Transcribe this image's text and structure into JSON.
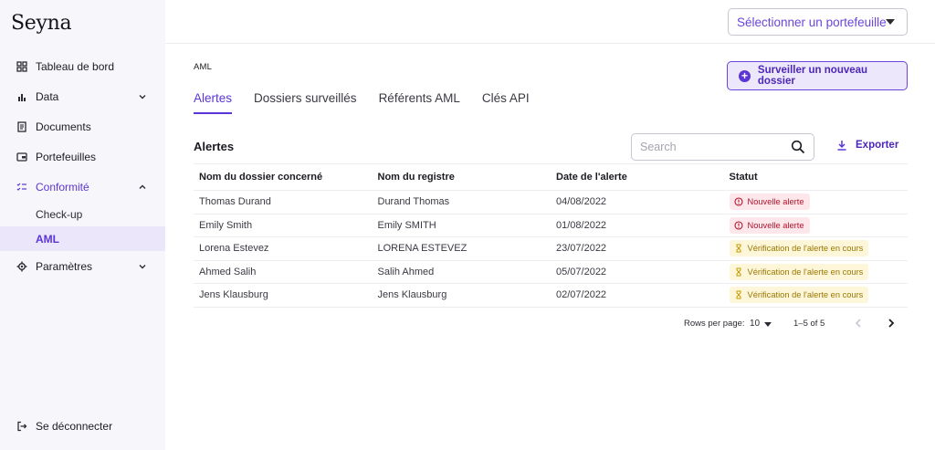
{
  "app": {
    "logo": "Seyna"
  },
  "sidebar": {
    "items": [
      {
        "label": "Tableau de bord",
        "icon": "dashboard-icon"
      },
      {
        "label": "Data",
        "icon": "bar-chart-icon"
      },
      {
        "label": "Documents",
        "icon": "document-icon"
      },
      {
        "label": "Portefeuilles",
        "icon": "wallet-icon"
      },
      {
        "label": "Conformité",
        "icon": "checklist-icon"
      },
      {
        "label": "Paramètres",
        "icon": "gear-icon"
      }
    ],
    "subitems": [
      {
        "label": "Check-up"
      },
      {
        "label": "AML"
      }
    ],
    "logout": "Se déconnecter"
  },
  "topbar": {
    "portfolio_select": "Sélectionner un portefeuille"
  },
  "main": {
    "breadcrumb": "AML",
    "primary_button": "Surveiller un nouveau dossier",
    "tabs": [
      "Alertes",
      "Dossiers surveillés",
      "Référents AML",
      "Clés API"
    ],
    "section_title": "Alertes",
    "search_placeholder": "Search",
    "export_label": "Exporter"
  },
  "table": {
    "headers": [
      "Nom du dossier concerné",
      "Nom du registre",
      "Date de l'alerte",
      "Statut"
    ],
    "rows": [
      {
        "dossier": "Thomas Durand",
        "registre": "Durand Thomas",
        "date": "04/08/2022",
        "status": "Nouvelle alerte",
        "status_type": "alert"
      },
      {
        "dossier": "Emily Smith",
        "registre": "Emily SMITH",
        "date": "01/08/2022",
        "status": "Nouvelle alerte",
        "status_type": "alert"
      },
      {
        "dossier": "Lorena Estevez",
        "registre": "LORENA ESTEVEZ",
        "date": "23/07/2022",
        "status": "Vérification de l'alerte en cours",
        "status_type": "pending"
      },
      {
        "dossier": "Ahmed Salih",
        "registre": "Salih Ahmed",
        "date": "05/07/2022",
        "status": "Vérification de l'alerte en cours",
        "status_type": "pending"
      },
      {
        "dossier": "Jens Klausburg",
        "registre": "Jens Klausburg",
        "date": "02/07/2022",
        "status": "Vérification de l'alerte en cours",
        "status_type": "pending"
      }
    ]
  },
  "pagination": {
    "rows_per_page_label": "Rows per page:",
    "rows_per_page": "10",
    "range": "1–5 of 5"
  },
  "colors": {
    "accent": "#5b35d5",
    "alert_bg": "#fde7ea",
    "alert_text": "#b3142e",
    "pending_bg": "#fdf6d9",
    "pending_text": "#9a7700",
    "sidebar_bg": "#f7f6fb"
  }
}
